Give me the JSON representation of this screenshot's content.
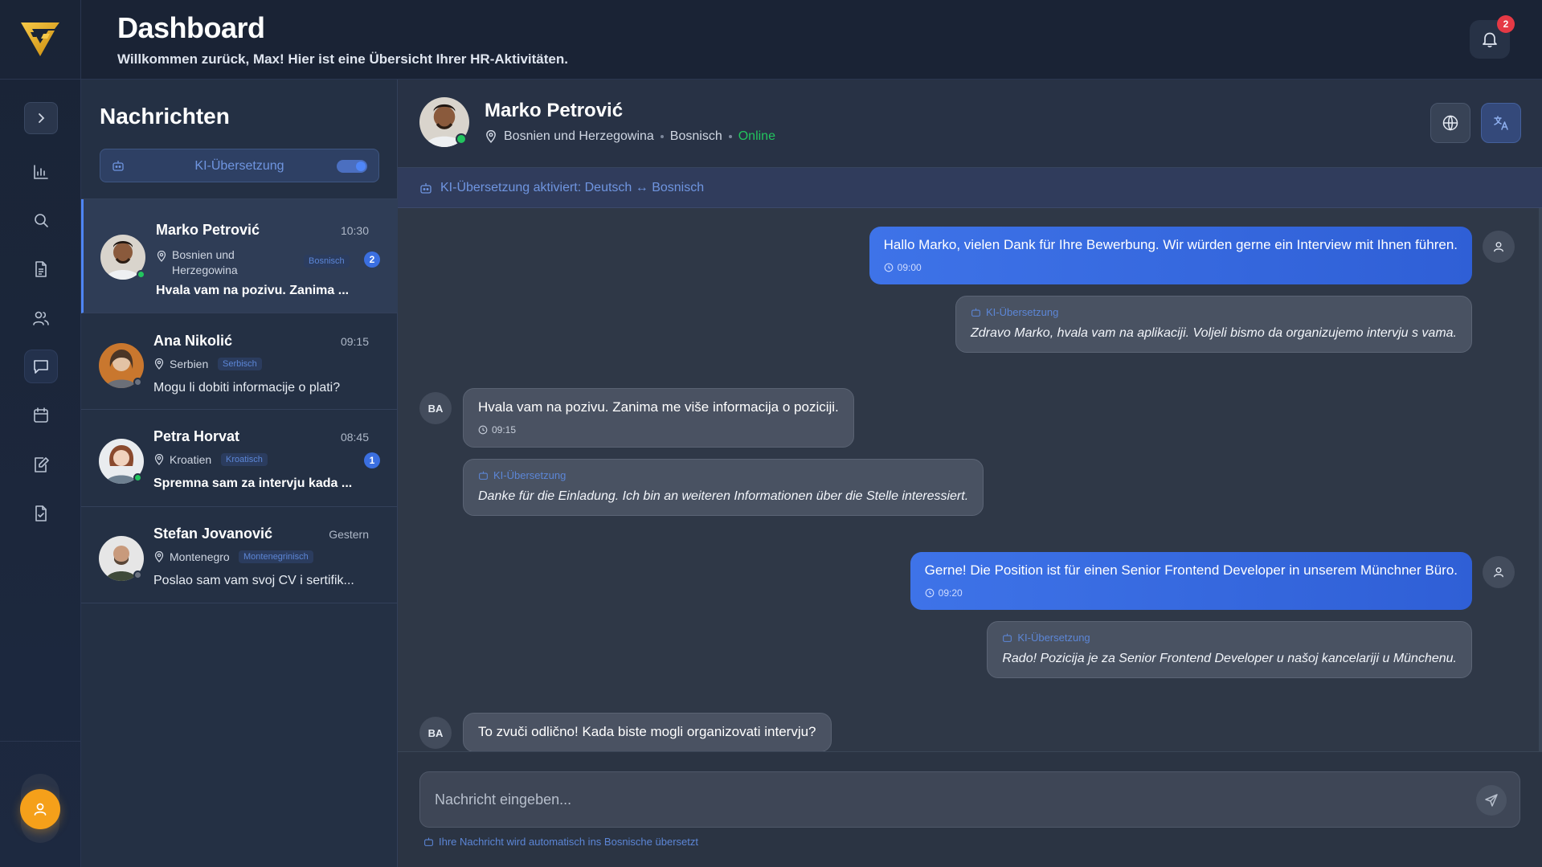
{
  "header": {
    "title": "Dashboard",
    "subtitle": "Willkommen zurück, Max! Hier ist eine Übersicht Ihrer HR-Aktivitäten.",
    "notification_count": "2"
  },
  "sidebar": {
    "items": [
      {
        "icon": "chart-icon"
      },
      {
        "icon": "search-icon"
      },
      {
        "icon": "document-icon"
      },
      {
        "icon": "users-icon"
      },
      {
        "icon": "message-icon",
        "active": true
      },
      {
        "icon": "calendar-icon"
      },
      {
        "icon": "edit-document-icon"
      },
      {
        "icon": "checklist-document-icon"
      }
    ]
  },
  "conversations": {
    "title": "Nachrichten",
    "ai_toggle_label": "KI-Übersetzung",
    "items": [
      {
        "name": "Marko Petrović",
        "time": "10:30",
        "location_line1": "Bosnien und",
        "location_line2": "Herzegowina",
        "language": "Bosnisch",
        "unread": "2",
        "preview": "Hvala vam na pozivu. Zanima ..."
      },
      {
        "name": "Ana Nikolić",
        "time": "09:15",
        "location": "Serbien",
        "language": "Serbisch",
        "preview": "Mogu li dobiti informacije o plati?"
      },
      {
        "name": "Petra Horvat",
        "time": "08:45",
        "location": "Kroatien",
        "language": "Kroatisch",
        "unread": "1",
        "preview": "Spremna sam za intervju kada ..."
      },
      {
        "name": "Stefan Jovanović",
        "time": "Gestern",
        "location": "Montenegro",
        "language": "Montenegrinisch",
        "preview": "Poslao sam vam svoj CV i sertifik..."
      }
    ]
  },
  "chat": {
    "contact_name": "Marko Petrović",
    "location": "Bosnien und Herzegowina",
    "language": "Bosnisch",
    "status": "Online",
    "banner": "KI-Übersetzung aktiviert: Deutsch ↔ Bosnisch",
    "translation_tag": "KI-Übersetzung",
    "incoming_initials": "BA",
    "messages": [
      {
        "direction": "out",
        "text": "Hallo Marko, vielen Dank für Ihre Bewerbung. Wir würden gerne ein Interview mit Ihnen führen.",
        "time": "09:00",
        "translation": "Zdravo Marko, hvala vam na aplikaciji. Voljeli bismo da organizujemo intervju s vama."
      },
      {
        "direction": "in",
        "text": "Hvala vam na pozivu. Zanima me više informacija o poziciji.",
        "time": "09:15",
        "translation": "Danke für die Einladung. Ich bin an weiteren Informationen über die Stelle interessiert."
      },
      {
        "direction": "out",
        "text": "Gerne! Die Position ist für einen Senior Frontend Developer in unserem Münchner Büro.",
        "time": "09:20",
        "translation": "Rado! Pozicija je za Senior Frontend Developer u našoj kancelariji u Münchenu."
      },
      {
        "direction": "in",
        "text": "To zvuči odlično! Kada biste mogli organizovati intervju?"
      }
    ],
    "composer": {
      "placeholder": "Nachricht eingeben...",
      "hint": "Ihre Nachricht wird automatisch ins Bosnische übersetzt"
    }
  },
  "colors": {
    "accent": "#3e73e8",
    "online": "#22c55e",
    "badge": "#e53945",
    "ai": "#6f95e0"
  }
}
